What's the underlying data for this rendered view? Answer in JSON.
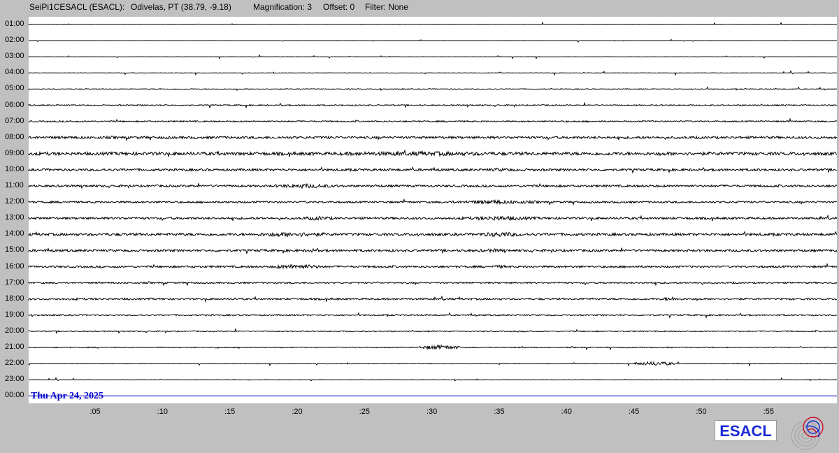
{
  "header": {
    "station": "SeiPi1CESACL (ESACL):",
    "location": "Odivelas, PT (38.79, -9.18)",
    "magnification": "Magnification: 3",
    "offset": "Offset: 0",
    "filter": "Filter: None"
  },
  "date_label": "Thu Apr 24, 2025",
  "logo_text": "ESACL",
  "colors": {
    "background": "#c0c0c0",
    "plot_bg": "#ffffff",
    "trace": "#000000",
    "current_line": "#0000cc"
  },
  "chart_data": {
    "type": "helicorder",
    "title": "",
    "rows": [
      "01:00",
      "02:00",
      "03:00",
      "04:00",
      "05:00",
      "06:00",
      "07:00",
      "08:00",
      "09:00",
      "10:00",
      "11:00",
      "12:00",
      "13:00",
      "14:00",
      "15:00",
      "16:00",
      "17:00",
      "18:00",
      "19:00",
      "20:00",
      "21:00",
      "22:00",
      "23:00",
      "00:00"
    ],
    "x_ticks": [
      ":05",
      ":10",
      ":15",
      ":20",
      ":25",
      ":30",
      ":35",
      ":40",
      ":45",
      ":50",
      ":55"
    ],
    "x_tick_minutes": [
      5,
      10,
      15,
      20,
      25,
      30,
      35,
      40,
      45,
      50,
      55
    ],
    "x_range_minutes": [
      0,
      60
    ],
    "row_noise_level": [
      0.3,
      0.25,
      0.25,
      0.35,
      0.6,
      0.9,
      1.0,
      1.7,
      2.2,
      1.6,
      1.5,
      1.3,
      1.5,
      1.8,
      1.6,
      1.4,
      1.1,
      1.3,
      1.0,
      0.8,
      0.7,
      0.5,
      0.35,
      0
    ],
    "bursts": [
      {
        "row": "08:00",
        "start_min": 3,
        "end_min": 5,
        "level": 2.2
      },
      {
        "row": "09:00",
        "start_min": 18,
        "end_min": 40,
        "level": 3.2
      },
      {
        "row": "10:00",
        "start_min": 33,
        "end_min": 37,
        "level": 2.4
      },
      {
        "row": "11:00",
        "start_min": 18,
        "end_min": 23,
        "level": 3.2
      },
      {
        "row": "12:00",
        "start_min": 31,
        "end_min": 38,
        "level": 3.0
      },
      {
        "row": "13:00",
        "start_min": 20,
        "end_min": 23,
        "level": 3.0
      },
      {
        "row": "13:00",
        "start_min": 32,
        "end_min": 38,
        "level": 3.2
      },
      {
        "row": "14:00",
        "start_min": 16,
        "end_min": 23,
        "level": 3.4
      },
      {
        "row": "14:00",
        "start_min": 33,
        "end_min": 37,
        "level": 3.6
      },
      {
        "row": "15:00",
        "start_min": 20,
        "end_min": 22,
        "level": 2.6
      },
      {
        "row": "15:00",
        "start_min": 33,
        "end_min": 36,
        "level": 2.6
      },
      {
        "row": "16:00",
        "start_min": 18,
        "end_min": 22,
        "level": 3.6
      },
      {
        "row": "16:00",
        "start_min": 34,
        "end_min": 36,
        "level": 2.4
      },
      {
        "row": "18:00",
        "start_min": 47,
        "end_min": 48.5,
        "level": 3.0
      },
      {
        "row": "21:00",
        "start_min": 29,
        "end_min": 32,
        "level": 3.4
      },
      {
        "row": "22:00",
        "start_min": 45,
        "end_min": 48,
        "level": 3.0
      }
    ],
    "current_row": "00:00",
    "current_minute": 60,
    "grid": false
  }
}
